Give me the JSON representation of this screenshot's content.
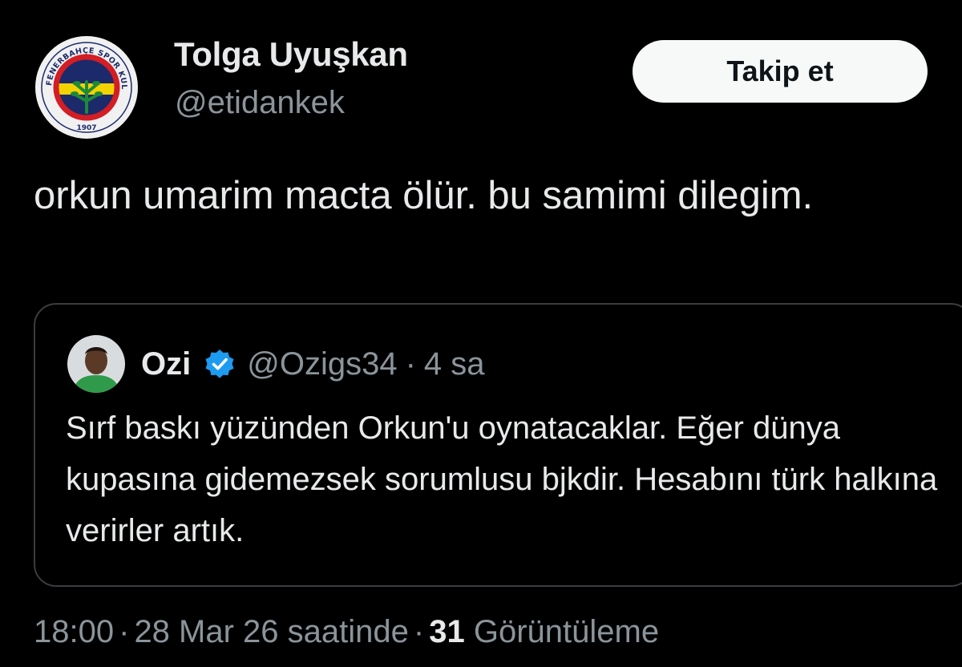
{
  "author": {
    "display_name": "Tolga Uyuşkan",
    "handle": "@etidankek",
    "avatar": "fenerbahce-crest-icon",
    "avatar_text_top": "FENERBAHÇE SPOR KULÜBÜ",
    "avatar_text_bottom": "1907"
  },
  "follow_button": {
    "label": "Takip et"
  },
  "tweet": {
    "text": "orkun umarim macta ölür. bu samimi dilegim."
  },
  "quoted_tweet": {
    "display_name": "Ozi",
    "verified_icon": "verified-badge-icon",
    "handle": "@Ozigs34",
    "separator": "·",
    "time": "4 sa",
    "text": "Sırf baskı yüzünden Orkun'u oynatacaklar. Eğer dünya kupasına gidemezsek sorumlusu bjkdir. Hesabını türk halkına verirler artık."
  },
  "meta": {
    "time": "18:00",
    "separator": "·",
    "date": "28 Mar 26 saatinde",
    "views_count": "31",
    "views_label": "Görüntüleme"
  },
  "colors": {
    "background": "#000000",
    "primary_text": "#e7e9ea",
    "secondary_text": "#8b949a",
    "follow_bg": "#f7f9f9",
    "verified": "#1d9bf0",
    "card_border": "#3a3d40"
  }
}
